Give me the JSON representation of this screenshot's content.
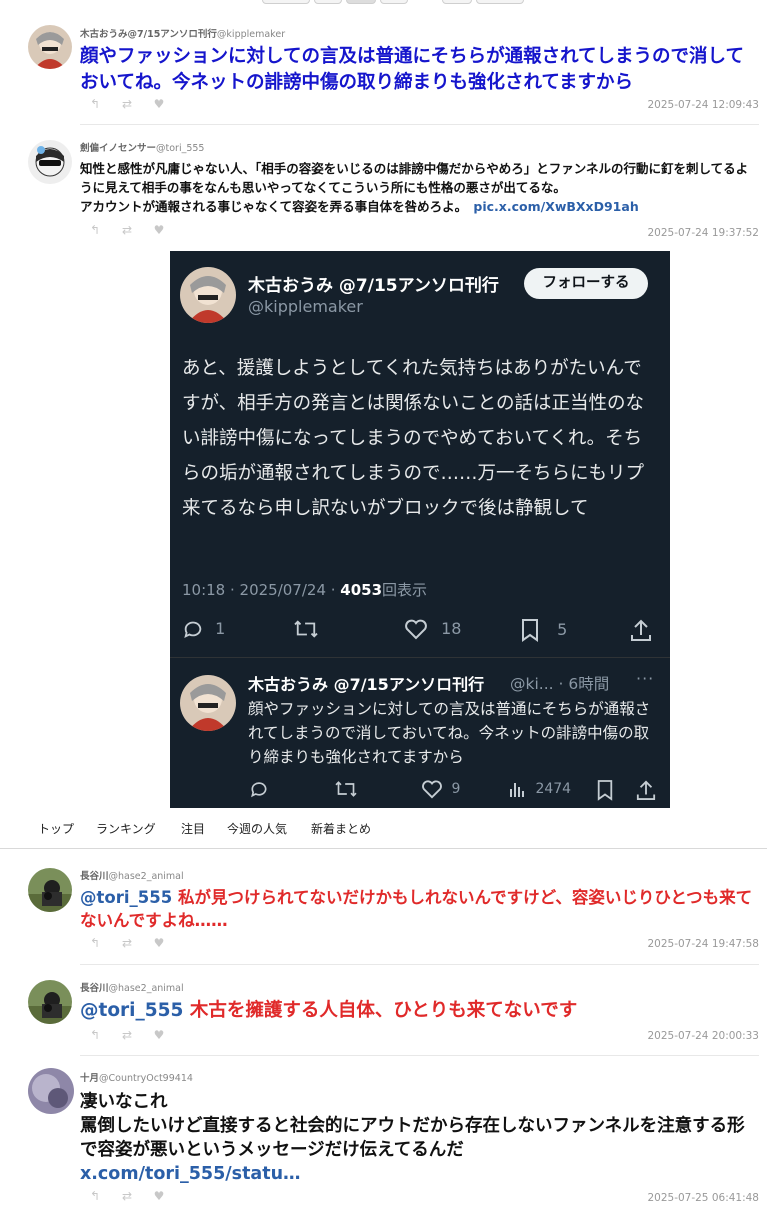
{
  "tweets": [
    {
      "name": "木古おうみ@7/15アンソロ刊行",
      "handle": "@kipplemaker",
      "text": "顔やファッションに対しての言及は普通にそちらが通報されてしまうので消しておいてね。今ネットの誹謗中傷の取り締まりも強化されてますから",
      "timestamp": "2025-07-24 12:09:43"
    },
    {
      "name": "劍偏イノセンサー",
      "handle": "@tori_555",
      "text": "知性と感性が凡庸じゃない人、「相手の容姿をいじるのは誹謗中傷だからやめろ」とファンネルの行動に釘を刺してるように見えて相手の事をなんも思いやってなくてこういう所にも性格の悪さが出てるな。\nアカウントが通報される事じゃなくて容姿を弄る事自体を咎めろよ。",
      "link": "pic.x.com/XwBXxD91ah",
      "timestamp": "2025-07-24 19:37:52"
    },
    {
      "name": "長谷川",
      "handle": "@hase2_animal",
      "mention": "@tori_555",
      "text": "私が見つけられてないだけかもしれないんですけど、容姿いじりひとつも来てないんですよね……",
      "timestamp": "2025-07-24 19:47:58"
    },
    {
      "name": "長谷川",
      "handle": "@hase2_animal",
      "mention": "@tori_555",
      "text": "木古を擁護する人自体、ひとりも来てないです",
      "timestamp": "2025-07-24 20:00:33"
    },
    {
      "name": "十月",
      "handle": "@CountryOct99414",
      "text": "凄いなこれ\n罵倒したいけど直接すると社会的にアウトだから存在しないファンネルを注意する形で容姿が悪いというメッセージだけ伝えてるんだ",
      "link": "x.com/tori_555/statu…",
      "timestamp": "2025-07-25 06:41:48"
    }
  ],
  "embed": {
    "name": "木古おうみ @7/15アンソロ刊行",
    "handle": "@kipplemaker",
    "follow": "フォローする",
    "text": "あと、援護しようとしてくれた気持ちはありがたいんですが、相手方の発言とは関係ないことの話は正当性のない誹謗中傷になってしまうのでやめておいてくれ。そちらの垢が通報されてしまうので……万一そちらにもリプ来てるなら申し訳ないがブロックで後は静観して",
    "time": "10:18 · 2025/07/24 · ",
    "views": "4053",
    "views_label": "回表示",
    "replies": "1",
    "likes": "18",
    "bookmarks": "5",
    "reply_name": "木古おうみ @7/15アンソロ刊行",
    "reply_handle": "@ki... · 6時間",
    "reply_text": "顔やファッションに対しての言及は普通にそちらが通報されてしまうので消しておいてね。今ネットの誹謗中傷の取り締まりも強化されてますから",
    "reply_likes": "9",
    "reply_views": "2474"
  },
  "nav": {
    "items": [
      "トップ",
      "ランキング",
      "注目",
      "今週の人気",
      "新着まとめ"
    ]
  }
}
